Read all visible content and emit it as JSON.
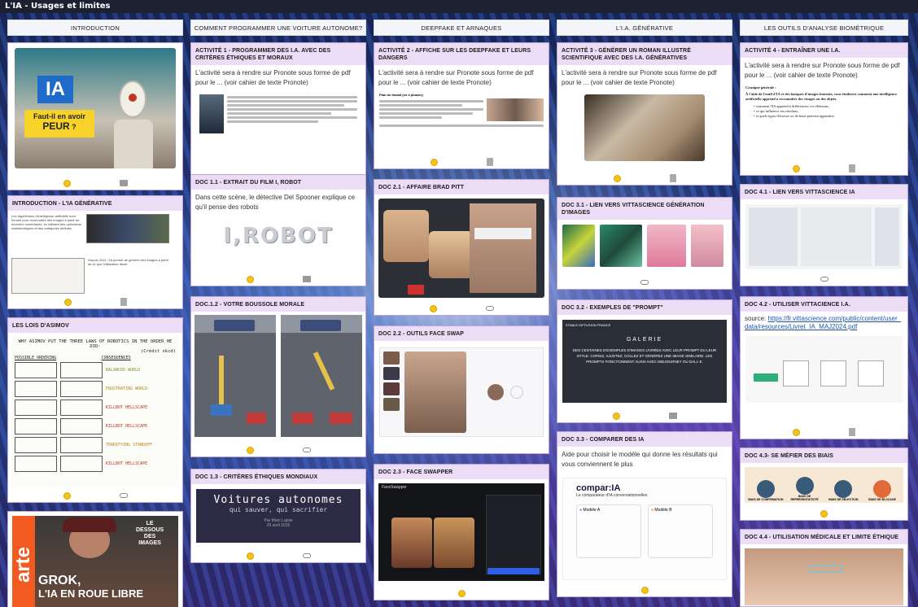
{
  "window": {
    "title": "L'IA - Usages et limites"
  },
  "columns": [
    {
      "title": "INTRODUCTION"
    },
    {
      "title": "COMMENT PROGRAMMER UNE VOITURE AUTONOME?"
    },
    {
      "title": "DEEPFAKE ET ARNAQUES"
    },
    {
      "title": "L'I.A. GÉNÉRATIVE"
    },
    {
      "title": "LES OUTILS D'ANALYSE BIOMÉTRIQUE"
    }
  ],
  "col1": {
    "card1": {
      "poster_ia": "IA",
      "poster_q1": "Faut-il en avoir",
      "poster_q2": "PEUR",
      "poster_q3": "?"
    },
    "card2": {
      "title": "INTRODUCTION - L'IA GÉNÉRATIVE",
      "body": "Les algorithmes d'intelligence artificielle sont formés pour reconnaître des images à partir de données numériques, en utilisant des opérations mathématiques et des catégories définies.",
      "body2": "Depuis 2014, l'IA permet de générer des images à partir de ce que l'utilisateur décrit."
    },
    "card3": {
      "title": "LES LOIS D'ASIMOV",
      "comic_title": "WHY ASIMOV PUT THE THREE LAWS OF ROBOTICS IN THE ORDER HE DID:",
      "comic_credit": "(Crédit xkcd)",
      "col_a": "POSSIBLE ORDERING",
      "col_b": "CONSEQUENCES",
      "results": [
        "BALANCED WORLD",
        "FRUSTRATING WORLD",
        "KILLBOT HELLSCAPE",
        "KILLBOT HELLSCAPE",
        "TERRIFYING STANDOFF",
        "KILLBOT HELLSCAPE"
      ]
    },
    "card4": {
      "brand": "arte",
      "tag1": "LE",
      "tag2": "DESSOUS",
      "tag3": "DES",
      "tag4": "IMAGES",
      "headline1": "GROK,",
      "headline2": "L'IA EN ROUE LIBRE"
    }
  },
  "col2": {
    "card1": {
      "title": "ACTIVITÉ 1 - PROGRAMMER DES I.A. AVEC DES CRITÈRES ÉTHIQUES ET MORAUX",
      "body": "L'activité sera à rendre sur Pronote sous forme de pdf pour le ... (voir cahier de texte Pronote)"
    },
    "card2": {
      "title": "DOC 1.1 - EXTRAIT DU FILM I, ROBOT",
      "body": "Dans cette scène, le détective Del Spooner explique ce qu'il pense des robots",
      "logo": "I,ROBOT"
    },
    "card3": {
      "title": "DOC.1.2 - VOTRE BOUSSOLE MORALE"
    },
    "card4": {
      "title": "DOC 1.3 - CRITÈRES ÉTHIQUES MONDIAUX",
      "banner1": "Voitures autonomes",
      "banner2": "qui sauver, qui sacrifier",
      "banner3": "Par Marc Lajoie",
      "banner4": "25 avril 2015"
    }
  },
  "col3": {
    "card1": {
      "title": "ACTIVITÉ 2 - AFFICHE SUR LES DEEPFAKE ET LEURS DANGERS",
      "body": "L'activité sera à rendre sur Pronote sous forme de pdf pour le ... (voir cahier de texte Pronote)",
      "doc_head": "Plan de travail (en 4 phases)"
    },
    "card2": {
      "title": "DOC 2.1 - AFFAIRE BRAD PITT"
    },
    "card3": {
      "title": "DOC 2.2 - OUTILS FACE SWAP"
    },
    "card4": {
      "title": "DOC 2.3 - FACE SWAPPER",
      "app": "FaceSwapper"
    }
  },
  "col4": {
    "card1": {
      "title": "ACTIVITÉ 3 - GÉNÉRER UN ROMAN ILLUSTRÉ SCIENTIFIQUE AVEC DES I.A. GÉNÉRATIVES",
      "body": "L'activité sera à rendre sur Pronote sous forme de pdf pour le ... (voir cahier de texte Pronote)"
    },
    "card2": {
      "title": "DOC 3.1 - LIEN VERS VITTASCIENCE GÉNÉRATION D'IMAGES"
    },
    "card3": {
      "title": "DOC 3.2 - EXEMPLES DE \"PROMPT\"",
      "head": "STABLE DIFFUSION FRANCE",
      "gal": "GALERIE",
      "desc": "DES CENTAINES D'EXEMPLES D'IMAGES LIVRÉES AVEC LEUR PROMPT DU LEUR STYLE. COPIEZ, AJUSTEZ, COLLEZ ET GÉNÉREZ UNE IMAGE SIMILAIRE. LES PROMPTS FONCTIONNENT AUSSI AVEC MIDJOURNEY OU DALL-E."
    },
    "card4": {
      "title": "DOC 3.3 - COMPARER DES IA",
      "body": "Aide pour choisir le modèle qui donne les résultats qui vous conviennent le plus",
      "logo": "compar:IA",
      "sub": "Le comparateur d'IA conversationnelles",
      "model_a": "Modèle A",
      "model_b": "Modèle B"
    }
  },
  "col5": {
    "card1": {
      "title": "ACTIVITÉ 4 - ENTRAÎNER UNE I.A.",
      "body": "L'activité sera à rendre sur Pronote sous forme de pdf pour le ... (voir cahier de texte Pronote)",
      "consigne": "Consigne générale :",
      "c1": "À l'aide de l'outil d'IA et des banques d'images fournies, vous étudierez comment une intelligence artificielle apprend à reconnaître des visages ou des objets.",
      "c2": "comment l'IA apprend à différencier ces éléments,",
      "c3": "ce qui influence ses résultats,",
      "c4": "et quels types d'erreurs ou de biais peuvent apparaître."
    },
    "card2": {
      "title": "DOC 4.1 - LIEN VERS VITTASCIENCE IA"
    },
    "card3": {
      "title": "DOC 4.2 - UTILISER VITTACIENCE I.A.",
      "source": "source:",
      "link": "https://fr.vittascience.com/public/content/user_data/resources/Livret_IA_MAJ2024.pdf"
    },
    "card4": {
      "title": "DOC 4.3- SE MÉFIER DES BIAIS",
      "biases": [
        "BIAIS DE CONFIRMATION",
        "BIAIS DE REPRÉSENTATIVITÉ",
        "BIAIS DE SÉLECTION",
        "BIAIS DE BLOCAGE"
      ]
    },
    "card5": {
      "title": "DOC 4.4 - UTILISATION MÉDICALE ET LIMITE ÉTHIQUE"
    }
  }
}
